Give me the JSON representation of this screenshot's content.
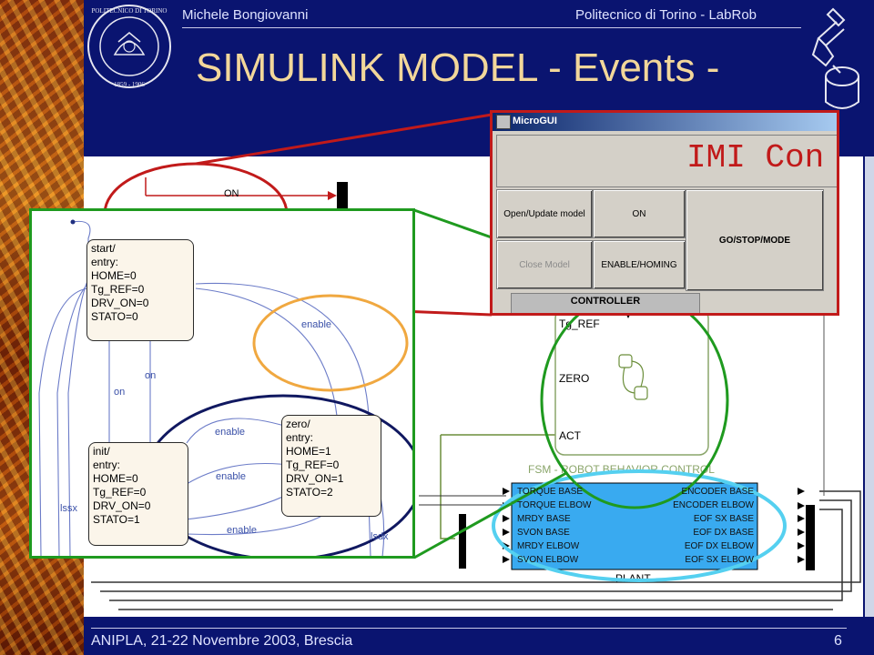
{
  "header": {
    "author": "Michele Bongiovanni",
    "institution": "Politecnico di Torino - LabRob",
    "title": "SIMULINK MODEL - Events -"
  },
  "footer": {
    "event": "ANIPLA, 21-22 Novembre 2003, Brescia",
    "page": "6"
  },
  "logo": {
    "ring_text": "POLITECNICO DI TORINO",
    "years": "1859 - 1906"
  },
  "gui": {
    "window_title": "MicroGUI",
    "banner": "IMI Con",
    "buttons": {
      "open_update": "Open/Update model",
      "on": "ON",
      "go_stop_mode": "GO/STOP/MODE",
      "close_model": "Close Model",
      "enable_homing": "ENABLE/HOMING"
    },
    "controller_label": "CONTROLLER"
  },
  "diagram": {
    "on_label": "ON",
    "fsm_ports": [
      "Tg_REF",
      "ZERO",
      "ACT"
    ],
    "fsm_caption": "FSM - ROBOT BEHAVIOR CONTROL",
    "plant_caption": "PLANT",
    "plant_inputs": [
      "TORQUE BASE",
      "TORQUE ELBOW",
      "MRDY BASE",
      "SVON BASE",
      "MRDY ELBOW",
      "SVON ELBOW"
    ],
    "plant_outputs": [
      "ENCODER BASE",
      "ENCODER ELBOW",
      "EOF SX BASE",
      "EOF DX BASE",
      "EOF DX ELBOW",
      "EOF SX ELBOW"
    ]
  },
  "stateflow": {
    "state_start": [
      "start/",
      "entry:",
      "HOME=0",
      "Tg_REF=0",
      "DRV_ON=0",
      "STATO=0"
    ],
    "state_init": [
      "init/",
      "entry:",
      "HOME=0",
      "Tg_REF=0",
      "DRV_ON=0",
      "STATO=1"
    ],
    "state_zero": [
      "zero/",
      "entry:",
      "HOME=1",
      "Tg_REF=0",
      "DRV_ON=1",
      "STATO=2"
    ],
    "labels": {
      "enable_top": "enable",
      "on_a": "on",
      "on_b": "on",
      "enable_1": "enable",
      "enable_2": "enable",
      "enable_3": "enable",
      "lssx": "lssx",
      "lsdx": "lsdx"
    }
  },
  "colors": {
    "background": "#0a1470",
    "title": "#f2d79a",
    "highlight_red": "#c11a1a",
    "highlight_green": "#1f9a1f",
    "highlight_orange": "#f0a840",
    "highlight_navy": "#101860",
    "highlight_cyan": "#55d0f0",
    "plant_fill": "#39aaf0"
  }
}
